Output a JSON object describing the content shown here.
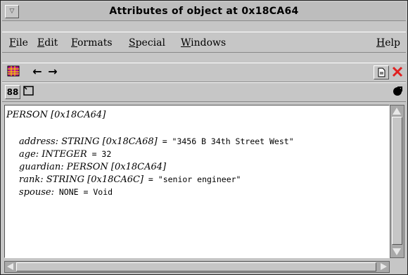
{
  "window": {
    "title": "Attributes of object at 0x18CA64"
  },
  "menubar": {
    "items": [
      {
        "underline": "F",
        "rest": "ile"
      },
      {
        "underline": "E",
        "rest": "dit"
      },
      {
        "underline": "F",
        "rest": "ormats"
      },
      {
        "underline": "S",
        "rest": "pecial"
      },
      {
        "underline": "W",
        "rest": "indows"
      }
    ],
    "help": {
      "underline": "H",
      "rest": "elp"
    }
  },
  "toolbar": {
    "back_glyph": "←",
    "forward_glyph": "→",
    "format_glyph": "88",
    "icons": [
      "grid-icon",
      "back-arrow-icon",
      "forward-arrow-icon",
      "document-icon",
      "close-x-icon",
      "format-icon",
      "frame-icon",
      "globe-icon"
    ]
  },
  "object": {
    "header_type": "PERSON",
    "header_addr": "[0x18CA64]",
    "attributes": [
      {
        "name": "address",
        "sep": ":",
        "type": "STRING",
        "addr": "[0x18CA68]",
        "value": " = \"3456 B 34th Street West\""
      },
      {
        "name": "age",
        "sep": ":",
        "type": "INTEGER",
        "addr": "",
        "value": " = 32"
      },
      {
        "name": "guardian",
        "sep": ":",
        "type": "PERSON",
        "addr": "[0x18CA64]",
        "value": ""
      },
      {
        "name": "rank",
        "sep": ":",
        "type": "STRING",
        "addr": "[0x18CA6C]",
        "value": " = \"senior engineer\""
      },
      {
        "name": "spouse",
        "sep": ":",
        "type": "",
        "addr": "",
        "value": " NONE = Void"
      }
    ]
  },
  "colors": {
    "close_red": "#e02020",
    "grid_magenta": "#c01090"
  }
}
